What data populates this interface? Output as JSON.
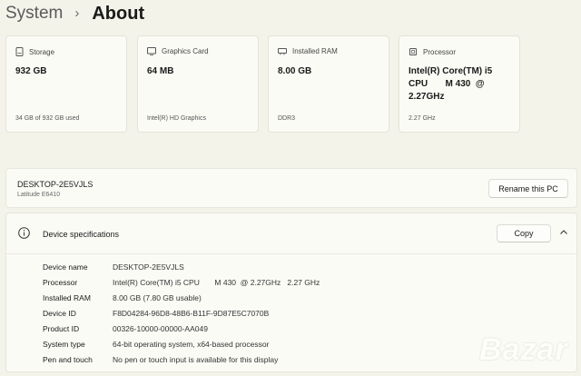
{
  "breadcrumb": {
    "parent": "System",
    "separator": "›",
    "current": "About"
  },
  "cards": [
    {
      "icon": "storage-icon",
      "title": "Storage",
      "value": "932 GB",
      "sub": "34 GB of 932 GB used"
    },
    {
      "icon": "graphics-card-icon",
      "title": "Graphics Card",
      "value": "64 MB",
      "sub": "Intel(R) HD Graphics"
    },
    {
      "icon": "ram-icon",
      "title": "Installed RAM",
      "value": "8.00 GB",
      "sub": "DDR3"
    },
    {
      "icon": "processor-icon",
      "title": "Processor",
      "value": "Intel(R) Core(TM) i5\nCPU       M 430  @\n2.27GHz",
      "sub": "2.27 GHz"
    }
  ],
  "device": {
    "name": "DESKTOP-2E5VJLS",
    "model": "Latitude E6410",
    "rename_label": "Rename this PC"
  },
  "specs": {
    "title": "Device specifications",
    "copy_label": "Copy",
    "rows": [
      {
        "label": "Device name",
        "value": "DESKTOP-2E5VJLS"
      },
      {
        "label": "Processor",
        "value": "Intel(R) Core(TM) i5 CPU       M 430  @ 2.27GHz   2.27 GHz"
      },
      {
        "label": "Installed RAM",
        "value": "8.00 GB (7.80 GB usable)"
      },
      {
        "label": "Device ID",
        "value": "F8D04284-96D8-48B6-B11F-9D87E5C7070B"
      },
      {
        "label": "Product ID",
        "value": "00326-10000-00000-AA049"
      },
      {
        "label": "System type",
        "value": "64-bit operating system, x64-based processor"
      },
      {
        "label": "Pen and touch",
        "value": "No pen or touch input is available for this display"
      }
    ]
  },
  "watermark": "Bazar"
}
